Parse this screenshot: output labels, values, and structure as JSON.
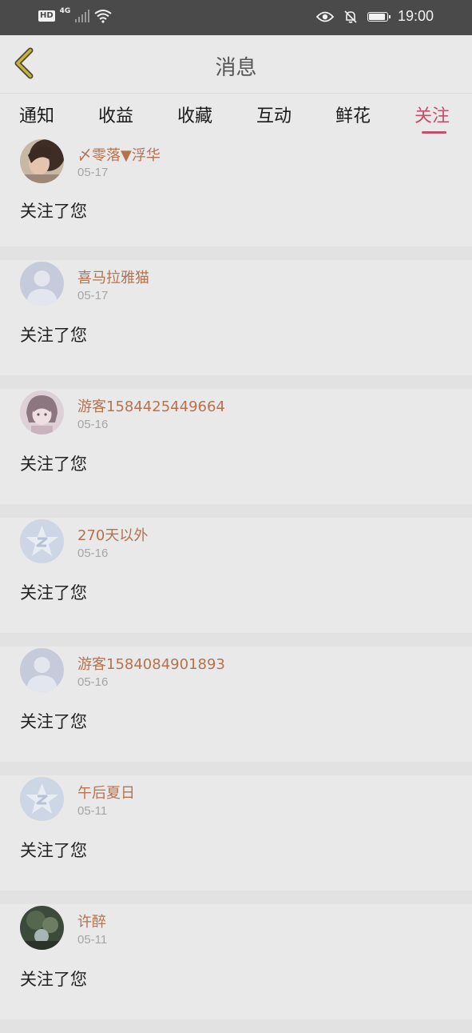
{
  "status_bar": {
    "hd": "HD",
    "network": "4G",
    "time": "19:00",
    "icons": [
      "signal-icon",
      "wifi-icon",
      "eye-icon",
      "bell-off-icon",
      "battery-icon"
    ]
  },
  "header": {
    "title": "消息",
    "back_icon": "chevron-left-icon"
  },
  "tabs": [
    {
      "label": "通知",
      "active": false
    },
    {
      "label": "收益",
      "active": false
    },
    {
      "label": "收藏",
      "active": false
    },
    {
      "label": "互动",
      "active": false
    },
    {
      "label": "鲜花",
      "active": false
    },
    {
      "label": "关注",
      "active": true
    }
  ],
  "colors": {
    "accent": "#c0506e",
    "username": "#b5724f",
    "background": "#e9e9e9",
    "status_bar": "#4a4a4a"
  },
  "notifications": [
    {
      "username": "〆零落▼浮华",
      "date": "05-17",
      "message": "关注了您",
      "avatar": "photo-avatar"
    },
    {
      "username": "喜马拉雅猫",
      "date": "05-17",
      "message": "关注了您",
      "avatar": "default-user-avatar"
    },
    {
      "username": "游客1584425449664",
      "date": "05-16",
      "message": "关注了您",
      "avatar": "anime-avatar"
    },
    {
      "username": "270天以外",
      "date": "05-16",
      "message": "关注了您",
      "avatar": "qq-star-avatar"
    },
    {
      "username": "游客1584084901893",
      "date": "05-16",
      "message": "关注了您",
      "avatar": "default-user-avatar"
    },
    {
      "username": "午后夏日",
      "date": "05-11",
      "message": "关注了您",
      "avatar": "qq-star-avatar"
    },
    {
      "username": "许醉",
      "date": "05-11",
      "message": "关注了您",
      "avatar": "photo-avatar"
    }
  ]
}
